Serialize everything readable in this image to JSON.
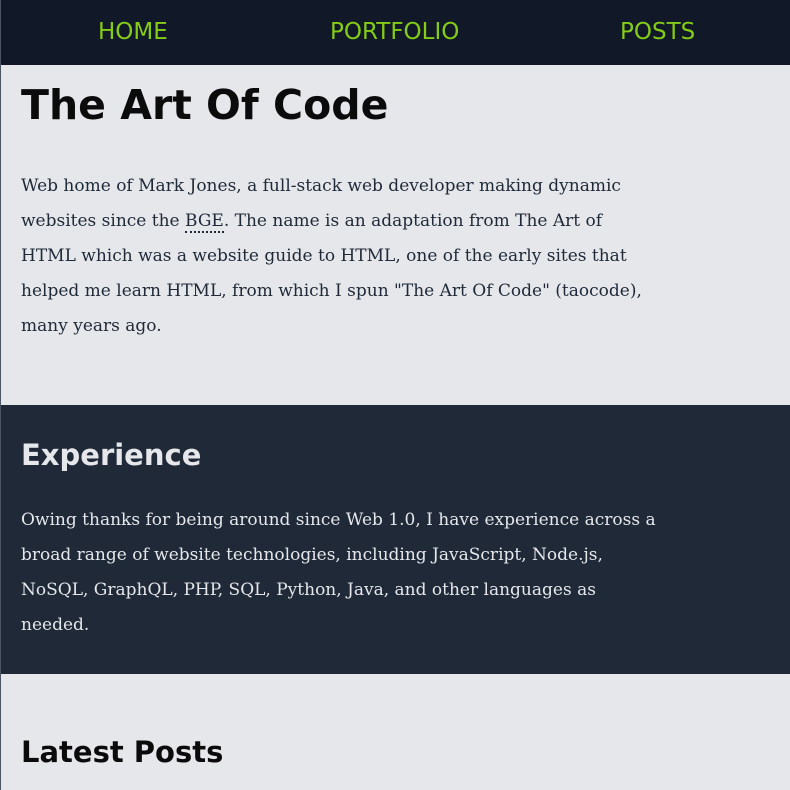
{
  "nav": {
    "items": [
      {
        "label": "HOME"
      },
      {
        "label": "PORTFOLIO"
      },
      {
        "label": "POSTS"
      }
    ]
  },
  "colors": {
    "nav_background": "#111827",
    "nav_link": "#84cc16",
    "light_section": "#e5e7eb",
    "dark_section": "#1f2937"
  },
  "intro": {
    "title": "The Art Of Code",
    "line_1": "Web home of Mark Jones, a full-stack web developer making dynamic",
    "line_2_before": "websites since the ",
    "abbr": "BGE",
    "line_2_after": ". The name is an adaptation from The Art of",
    "line_3": "HTML which was a website guide to HTML, one of the early sites that",
    "line_4": "helped me learn HTML, from which I spun \"The Art Of Code\" (taocode),",
    "line_5": "many years ago."
  },
  "experience": {
    "heading": "Experience",
    "line_1": "Owing thanks for being around since Web 1.0, I have experience across a",
    "line_2": "broad range of website technologies, including JavaScript, Node.js,",
    "line_3": "NoSQL, GraphQL, PHP, SQL, Python, Java, and other languages as",
    "line_4": "needed."
  },
  "posts": {
    "heading": "Latest Posts"
  }
}
